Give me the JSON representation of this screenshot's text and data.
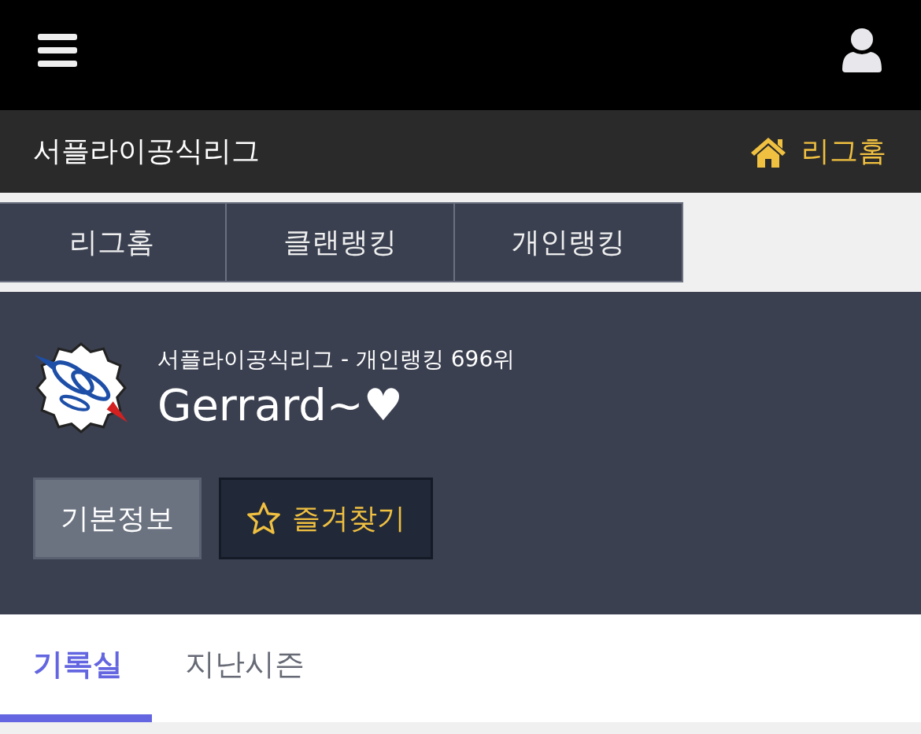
{
  "league_bar": {
    "title": "서플라이공식리그",
    "home_link": "리그홈"
  },
  "nav_tabs": [
    {
      "label": "리그홈"
    },
    {
      "label": "클랜랭킹"
    },
    {
      "label": "개인랭킹"
    }
  ],
  "profile": {
    "subtitle": "서플라이공식리그 - 개인랭킹 696위",
    "name": "Gerrard~♥",
    "buttons": [
      {
        "label": "기본정보",
        "kind": "info"
      },
      {
        "label": "즐겨찾기",
        "kind": "favorite"
      }
    ]
  },
  "tabs": [
    {
      "label": "기록실",
      "selected": true
    },
    {
      "label": "지난시즌",
      "selected": false
    }
  ]
}
